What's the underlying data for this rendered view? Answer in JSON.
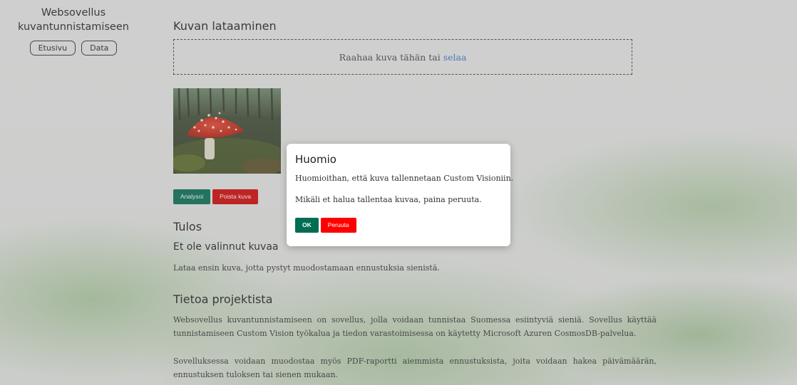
{
  "sidebar": {
    "title_line1": "Websovellus",
    "title_line2": "kuvantunnistamiseen",
    "nav": [
      "Etusivu",
      "Data"
    ]
  },
  "upload": {
    "title": "Kuvan lataaminen",
    "drop_text": "Raahaa kuva tähän tai",
    "browse_link": "selaa"
  },
  "image_actions": {
    "analyze_label": "Analysoi",
    "delete_label": "Poista kuva"
  },
  "result": {
    "title": "Tulos",
    "subtitle": "Et ole valinnut kuvaa",
    "text": "Lataa ensin kuva, jotta pystyt muodostamaan ennustuksia sienistä."
  },
  "about": {
    "title": "Tietoa projektista",
    "paragraph1": "Websovellus kuvantunnistamiseen on sovellus, jolla voidaan tunnistaa Suomessa esiintyviä sieniä. Sovellus käyttää tunnistamiseen Custom Vision työkalua ja tiedon varastoimisessa on käytetty Microsoft Azuren CosmosDB-palvelua.",
    "paragraph2": "Sovelluksessa voidaan muodostaa myös PDF-raportti aiemmista ennustuksista, joita voidaan hakea päivämäärän, ennustuksen tuloksen tai sienen mukaan."
  },
  "modal": {
    "title": "Huomio",
    "line1": "Huomioithan, että kuva tallennetaan Custom Visioniin.",
    "line2": "Mikäli et halua tallentaa kuvaa, paina peruuta.",
    "ok_label": "OK",
    "cancel_label": "Peruuta"
  },
  "colors": {
    "primary_green": "#006e53",
    "danger_red": "#d70000",
    "cancel_red": "#ff0000",
    "link_blue": "#3978c8"
  }
}
